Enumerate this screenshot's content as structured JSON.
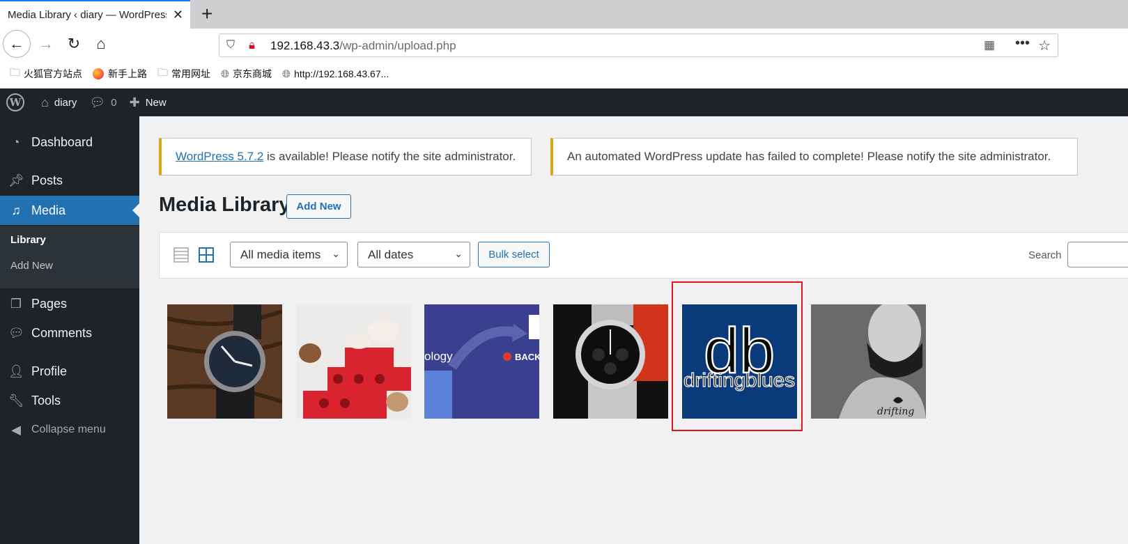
{
  "browser": {
    "tab_title": "Media Library ‹ diary — WordPress",
    "url_host": "192.168.43.3",
    "url_path": "/wp-admin/upload.php",
    "bookmarks": [
      "火狐官方站点",
      "新手上路",
      "常用网址",
      "京东商城",
      "http://192.168.43.67..."
    ]
  },
  "adminbar": {
    "site_name": "diary",
    "comments_count": "0",
    "new_label": "New"
  },
  "sidebar": {
    "items": [
      {
        "label": "Dashboard"
      },
      {
        "label": "Posts"
      },
      {
        "label": "Media"
      },
      {
        "label": "Pages"
      },
      {
        "label": "Comments"
      },
      {
        "label": "Profile"
      },
      {
        "label": "Tools"
      },
      {
        "label": "Collapse menu"
      }
    ],
    "submenu": [
      "Library",
      "Add New"
    ]
  },
  "notices": {
    "update_link": "WordPress 5.7.2",
    "update_text": " is available! Please notify the site administrator.",
    "failed_text": "An automated WordPress update has failed to complete! Please notify the site administrator."
  },
  "main": {
    "title": "Media Library",
    "add_new": "Add New",
    "filter_type": "All media items",
    "filter_date": "All dates",
    "bulk_select": "Bulk select",
    "search_label": "Search"
  },
  "media": {
    "logo_letters": "db",
    "logo_word": "driftingblues",
    "banner_fragment": "ology",
    "banner_fragment2": "BACK",
    "tattoo_word": "drifting"
  },
  "colors": {
    "accent": "#2271b1",
    "admin_dark": "#1d2327",
    "notice_warning": "#dba617",
    "selection": "#e0141e",
    "logo_bg": "#0a3a7a"
  }
}
